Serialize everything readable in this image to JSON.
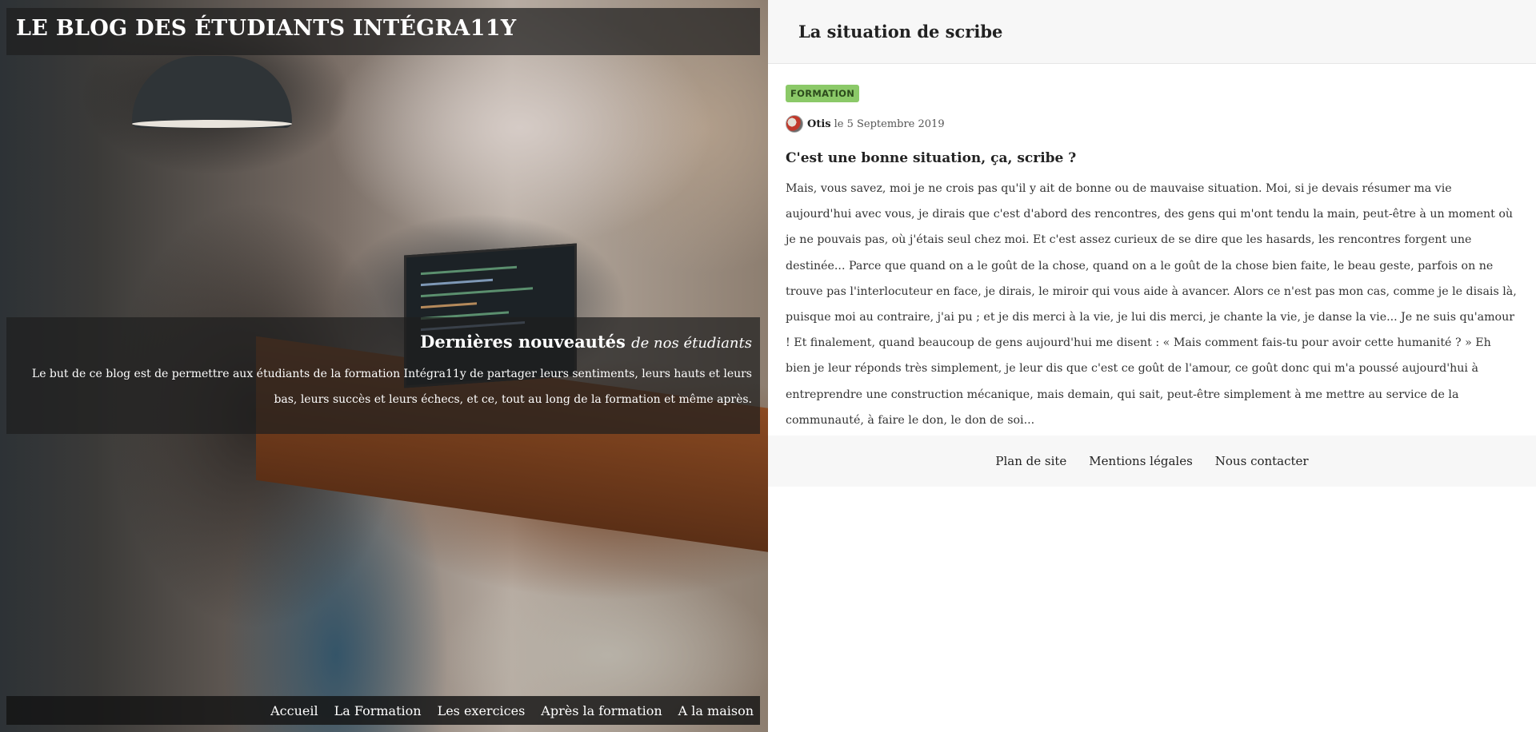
{
  "site": {
    "title": "LE BLOG DES ÉTUDIANTS INTÉGRA11Y"
  },
  "intro": {
    "heading": "Dernières nouveautés",
    "heading_em": "de nos étudiants",
    "text": "Le but de ce blog est de permettre aux étudiants de la formation Intégra11y de partager leurs sentiments, leurs hauts et leurs bas, leurs succès et leurs échecs, et ce, tout au long de la formation et même après."
  },
  "nav": {
    "items": [
      {
        "label": "Accueil"
      },
      {
        "label": "La Formation"
      },
      {
        "label": "Les exercices"
      },
      {
        "label": "Après la formation"
      },
      {
        "label": "A la maison"
      }
    ]
  },
  "article": {
    "page_title": "La situation de scribe",
    "tag": "FORMATION",
    "author": "Otis",
    "date": "le 5 Septembre 2019",
    "post_title": "C'est une bonne situation, ça, scribe ?",
    "excerpt": "Mais, vous savez, moi je ne crois pas qu'il y ait de bonne ou de mauvaise situation. Moi, si je devais résumer ma vie aujourd'hui avec vous, je dirais que c'est d'abord des rencontres, des gens qui m'ont tendu la main, peut-être à un moment où je ne pouvais pas, où j'étais seul chez moi. Et c'est assez curieux de se dire que les hasards, les rencontres forgent une destinée... Parce que quand on a le goût de la chose, quand on a le goût de la chose bien faite, le beau geste, parfois on ne trouve pas l'interlocuteur en face, je dirais, le miroir qui vous aide à avancer. Alors ce n'est pas mon cas, comme je le disais là, puisque moi au contraire, j'ai pu ; et je dis merci à la vie, je lui dis merci, je chante la vie, je danse la vie... Je ne suis qu'amour ! Et finalement, quand beaucoup de gens aujourd'hui me disent : « Mais comment fais-tu pour avoir cette humanité ? » Eh bien je leur réponds très simplement, je leur dis que c'est ce goût de l'amour, ce goût donc qui m'a poussé aujourd'hui à entreprendre une construction mécanique, mais demain, qui sait, peut-être simplement à me mettre au service de la communauté, à faire le don, le don de soi..."
  },
  "footer": {
    "links": [
      {
        "label": "Plan de site"
      },
      {
        "label": "Mentions légales"
      },
      {
        "label": "Nous contacter"
      }
    ]
  },
  "colors": {
    "tag_bg": "#8bc968",
    "overlay": "#1e1e1e",
    "panel_bg": "#f7f7f7"
  }
}
